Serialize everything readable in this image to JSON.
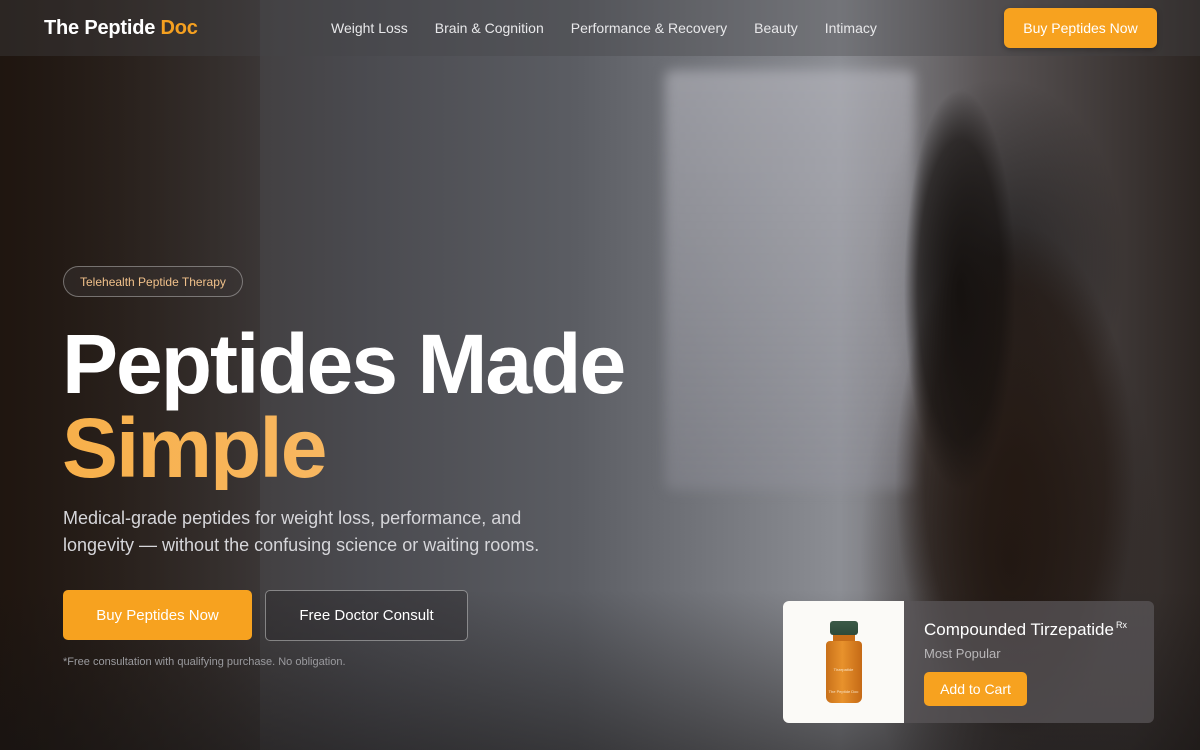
{
  "nav": {
    "logo_main": "The Peptide",
    "logo_accent": "Doc",
    "links": [
      "Weight Loss",
      "Brain & Cognition",
      "Performance & Recovery",
      "Beauty",
      "Intimacy"
    ],
    "cta_label": "Buy Peptides Now"
  },
  "hero": {
    "badge": "Telehealth Peptide Therapy",
    "headline_line1": "Peptides Made",
    "headline_line2": "Simple",
    "subheadline": "Medical-grade peptides for weight loss, performance, and longevity — without the confusing science or waiting rooms.",
    "primary_cta": "Buy Peptides Now",
    "secondary_cta": "Free Doctor Consult",
    "disclaimer": "*Free consultation with qualifying purchase. No obligation."
  },
  "product_card": {
    "name": "Compounded Tirzepatide",
    "superscript": "Rx",
    "tag": "Most Popular",
    "cta_label": "Add to Cart",
    "vial_label": "Tirzepatide",
    "vial_brand": "The Peptide Doc"
  },
  "colors": {
    "accent": "#f7a21f",
    "headline_accent": "#f7b04a",
    "background": "#2b2a2d"
  }
}
